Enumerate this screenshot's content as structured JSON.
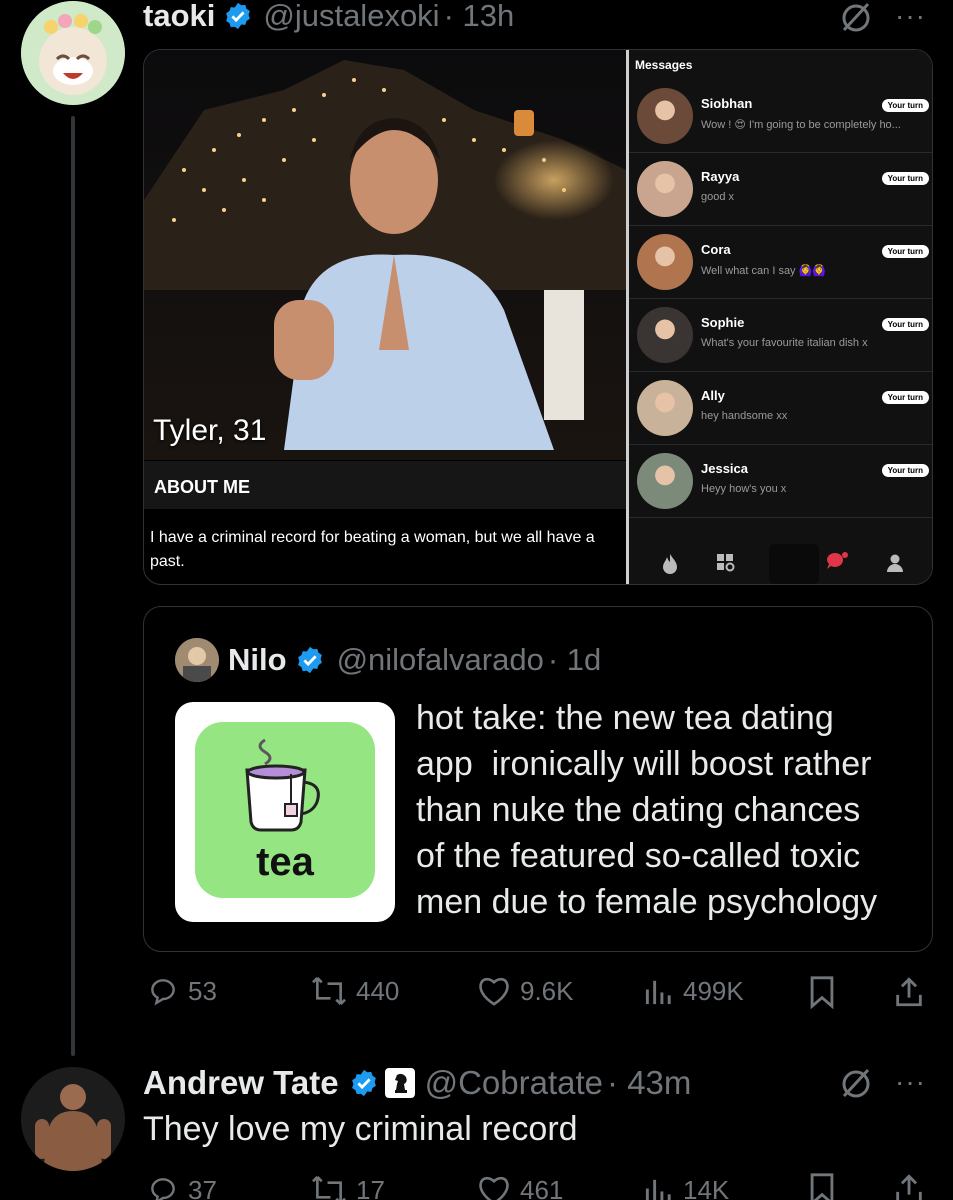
{
  "tweet1": {
    "name": "taoki",
    "handle": "@justalexoki",
    "time": "· 13h",
    "more": "···",
    "media": {
      "profile_name_age": "Tyler, 31",
      "about_heading": "ABOUT ME",
      "about_text": "I have a criminal record for beating a woman, but we all have a past.",
      "messages_title": "Messages",
      "messages": [
        {
          "name": "Siobhan",
          "preview": "Wow ! 😍 I'm going to be completely ho...",
          "badge": "Your turn",
          "avatar_color": "#6b4a3a"
        },
        {
          "name": "Rayya",
          "preview": "good x",
          "badge": "Your turn",
          "avatar_color": "#c9a58f"
        },
        {
          "name": "Cora",
          "preview": "Well what can I say 🙆‍♀️🙆‍♀️",
          "badge": "Your turn",
          "avatar_color": "#b0754f"
        },
        {
          "name": "Sophie",
          "preview": "What's your favourite italian dish x",
          "badge": "Your turn",
          "avatar_color": "#3a3532"
        },
        {
          "name": "Ally",
          "preview": "hey handsome xx",
          "badge": "Your turn",
          "avatar_color": "#c8b29a"
        },
        {
          "name": "Jessica",
          "preview": "Heyy how's you x",
          "badge": "Your turn",
          "avatar_color": "#7c8a7a"
        }
      ]
    },
    "quote": {
      "name": "Nilo",
      "handle": "@nilofalvarado",
      "time": "· 1d",
      "app_label": "tea",
      "text_lines": [
        "hot take: the new tea dating",
        "app  ironically will boost rather",
        "than nuke the dating chances",
        "of the featured so-called toxic",
        "men due to female psychology"
      ]
    },
    "actions": {
      "replies": "53",
      "reposts": "440",
      "likes": "9.6K",
      "views": "499K"
    }
  },
  "tweet2": {
    "name": "Andrew Tate",
    "handle": "@Cobratate",
    "time": "· 43m",
    "more": "···",
    "text": "They love my criminal record",
    "actions": {
      "replies": "37",
      "reposts": "17",
      "likes": "461",
      "views": "14K"
    }
  },
  "colors": {
    "verified": "#1d9bf0",
    "muted": "#71767b",
    "border": "#2f3336",
    "tea_green": "#95e582",
    "tea_purple": "#b58ed8"
  }
}
